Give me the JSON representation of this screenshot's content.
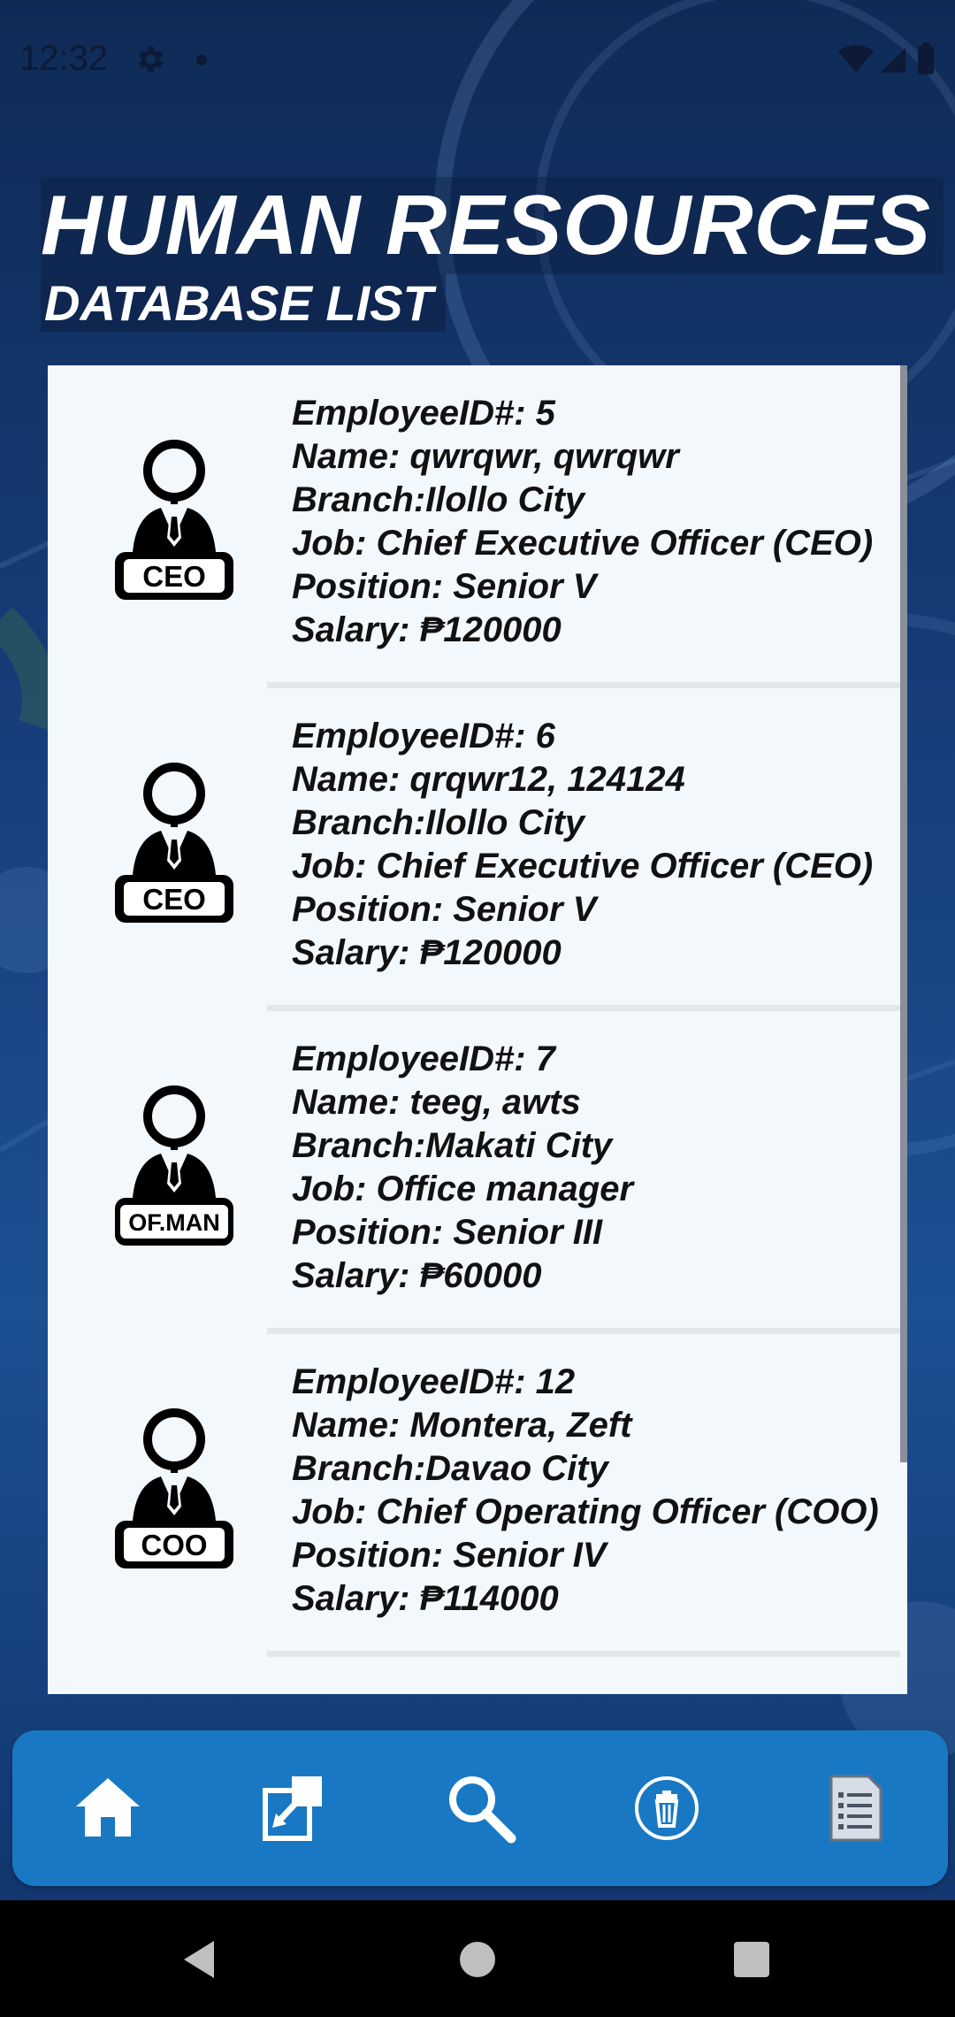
{
  "status_bar": {
    "time": "12:32"
  },
  "header": {
    "title": "HUMAN RESOURCES",
    "subtitle": "DATABASE LIST"
  },
  "employees": [
    {
      "id_label": "EmployeeID#: 5",
      "name_label": "Name: qwrqwr, qwrqwr",
      "branch_label": "Branch:Ilollo City",
      "job_label": "Job: Chief Executive Officer (CEO)",
      "position_label": "Position: Senior V",
      "salary_label": "Salary: ₱120000",
      "badge": "CEO"
    },
    {
      "id_label": "EmployeeID#: 6",
      "name_label": "Name: qrqwr12, 124124",
      "branch_label": "Branch:Ilollo City",
      "job_label": "Job: Chief Executive Officer (CEO)",
      "position_label": "Position: Senior V",
      "salary_label": "Salary: ₱120000",
      "badge": "CEO"
    },
    {
      "id_label": "EmployeeID#: 7",
      "name_label": "Name: teeg, awts",
      "branch_label": "Branch:Makati City",
      "job_label": "Job: Office manager",
      "position_label": "Position: Senior III",
      "salary_label": "Salary: ₱60000",
      "badge": "OF.MAN"
    },
    {
      "id_label": "EmployeeID#: 12",
      "name_label": "Name: Montera, Zeft",
      "branch_label": "Branch:Davao City",
      "job_label": "Job: Chief Operating Officer (COO)",
      "position_label": "Position: Senior IV",
      "salary_label": "Salary: ₱114000",
      "badge": "COO"
    }
  ],
  "bottom_nav": {
    "items": [
      {
        "icon": "home-icon"
      },
      {
        "icon": "edit-icon"
      },
      {
        "icon": "search-icon"
      },
      {
        "icon": "delete-icon"
      },
      {
        "icon": "list-icon"
      }
    ]
  },
  "colors": {
    "nav_bar": "#1878c4",
    "panel": "#f3f8fd",
    "background": "#163d7a"
  }
}
